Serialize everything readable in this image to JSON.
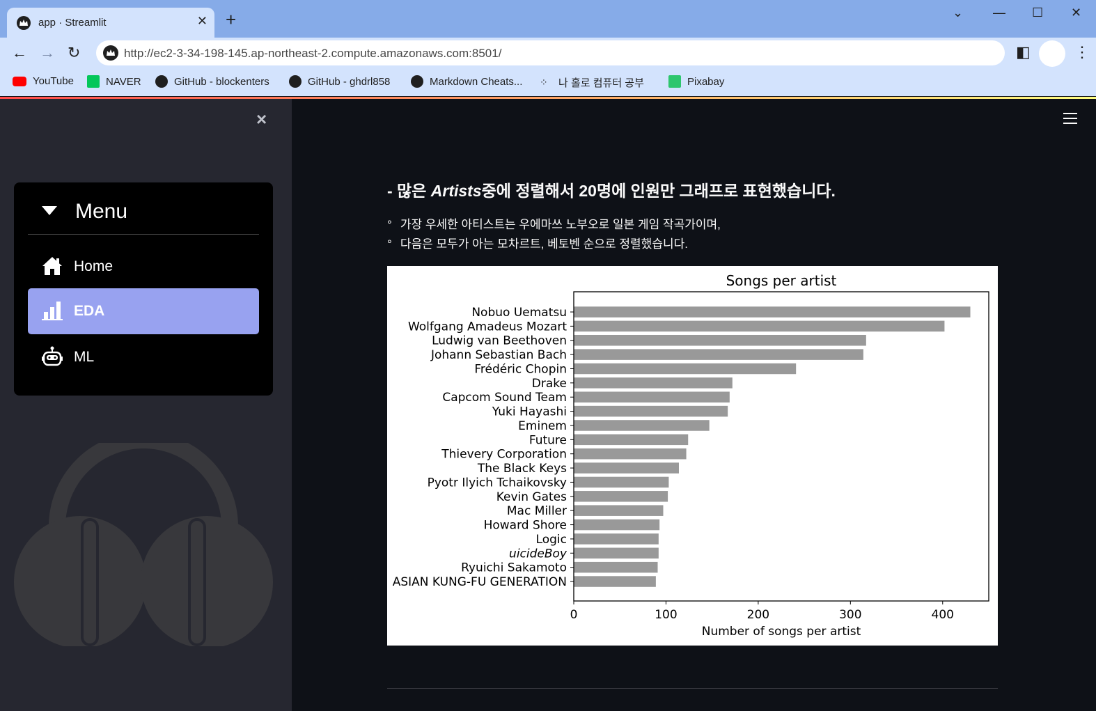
{
  "browser": {
    "tab_title": "app · Streamlit",
    "new_tab": "+",
    "url": "http://ec2-3-34-198-145.ap-northeast-2.compute.amazonaws.com:8501/",
    "bookmarks": [
      {
        "label": "YouTube",
        "icon": "youtube-icon",
        "color": "#ff0000"
      },
      {
        "label": "NAVER",
        "icon": "naver-icon",
        "color": "#03c75a"
      },
      {
        "label": "GitHub - blockenters",
        "icon": "github-icon",
        "color": "#1f1f1f"
      },
      {
        "label": "GitHub - ghdrl858",
        "icon": "github-icon",
        "color": "#1f1f1f"
      },
      {
        "label": "Markdown Cheats...",
        "icon": "github-icon",
        "color": "#1f1f1f"
      },
      {
        "label": "나 홀로 컴퓨터 공부",
        "icon": "dots-icon",
        "color": "#1f1f1f"
      },
      {
        "label": "Pixabay",
        "icon": "pixabay-icon",
        "color": "#2ec66d"
      }
    ]
  },
  "sidebar": {
    "close_glyph": "×",
    "menu_title": "Menu",
    "items": [
      {
        "label": "Home",
        "icon": "home-icon",
        "active": false
      },
      {
        "label": "EDA",
        "icon": "bar-chart-icon",
        "active": true
      },
      {
        "label": "ML",
        "icon": "robot-icon",
        "active": false
      }
    ],
    "accent": "#98a2f0"
  },
  "main": {
    "heading_prefix": "- 많은 ",
    "heading_em": "Artists",
    "heading_suffix": "중에 정렬해서 20명에 인원만 그래프로 표현했습니다.",
    "bullets": [
      "가장 우세한 아티스트는 우에마쓰 노부오로 일본 게임 작곡가이며,",
      "다음은 모두가 아는 모차르트, 베토벤 순으로 정렬했습니다."
    ]
  },
  "chart_data": {
    "type": "bar",
    "orientation": "horizontal",
    "title": "Songs per artist",
    "xlabel": "Number of songs per artist",
    "ylabel": "",
    "xlim": [
      0,
      450
    ],
    "xticks": [
      0,
      100,
      200,
      300,
      400
    ],
    "bar_color": "#999999",
    "categories": [
      "Nobuo Uematsu",
      "Wolfgang Amadeus Mozart",
      "Ludwig van Beethoven",
      "Johann Sebastian Bach",
      "Frédéric Chopin",
      "Drake",
      "Capcom Sound Team",
      "Yuki Hayashi",
      "Eminem",
      "Future",
      "Thievery Corporation",
      "The Black Keys",
      "Pyotr Ilyich Tchaikovsky",
      "Kevin Gates",
      "Mac Miller",
      "Howard Shore",
      "Logic",
      "uicideBoy",
      "Ryuichi Sakamoto",
      "ASIAN KUNG-FU GENERATION"
    ],
    "italic_categories": [
      "uicideBoy"
    ],
    "values": [
      430,
      402,
      317,
      314,
      241,
      172,
      169,
      167,
      147,
      124,
      122,
      114,
      103,
      102,
      97,
      93,
      92,
      92,
      91,
      89
    ]
  }
}
